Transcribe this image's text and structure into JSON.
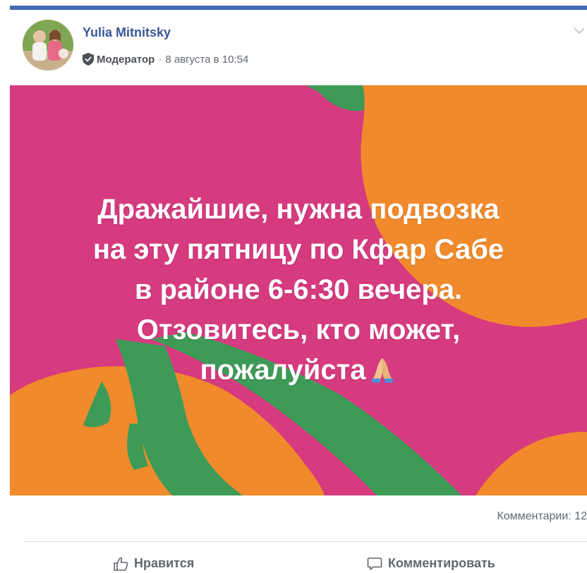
{
  "post": {
    "author_name": "Yulia Mitnitsky",
    "role_badge": "Модератор",
    "separator": "·",
    "timestamp": "8 августа в 10:54",
    "text_lines": [
      "Дражайшие, нужна подвозка",
      "на эту пятницу по Кфар Сабе",
      "в районе 6-6:30 вечера.",
      "Отзовитесь, кто может,",
      "пожалуйста"
    ],
    "emoji": "🙏",
    "background_colors": {
      "magenta": "#d63a7f",
      "orange": "#f08a2c",
      "green": "#3e9b57"
    },
    "comments_count_label": "Комментарии: 12"
  },
  "actions": {
    "like_label": "Нравится",
    "comment_label": "Комментировать"
  },
  "colors": {
    "brand_blue": "#4267b2",
    "name_link": "#385898",
    "meta_grey": "#616770"
  },
  "icons": [
    "shield-icon",
    "chevron-down-icon",
    "thumbs-up-icon",
    "comment-icon",
    "folded-hands-icon"
  ]
}
